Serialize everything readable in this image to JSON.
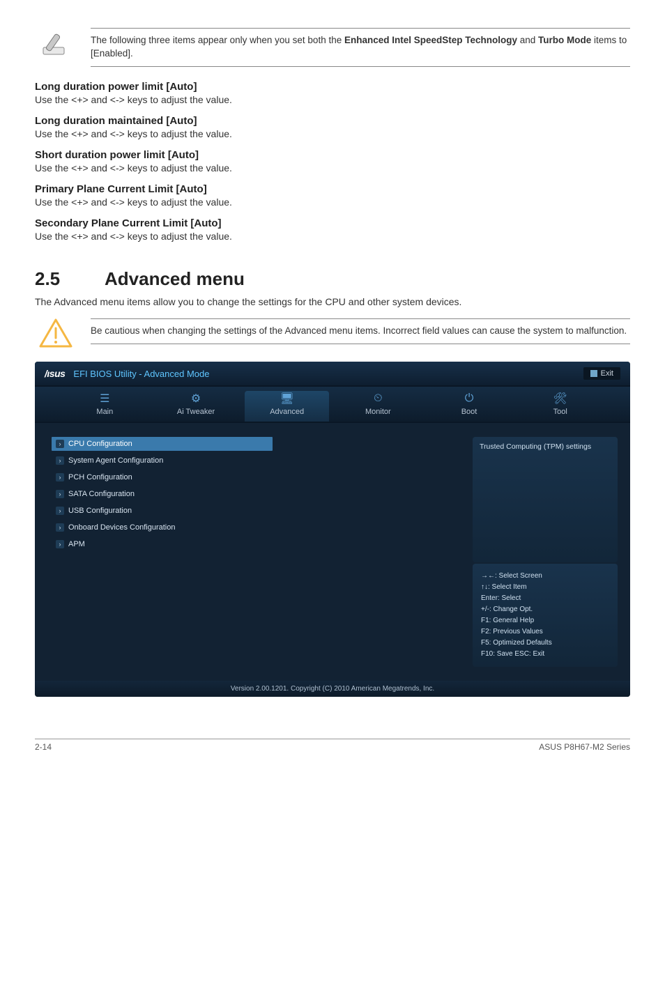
{
  "note1": {
    "line1_pre": "The following three items appear only when you set both the ",
    "bold1": "Enhanced Intel SpeedStep Technology",
    "mid": " and ",
    "bold2": "Turbo Mode",
    "post": " items to [Enabled]."
  },
  "sections": {
    "s1": {
      "heading": "Long duration power limit [Auto]",
      "body": "Use the <+> and <-> keys to adjust the value."
    },
    "s2": {
      "heading": "Long duration maintained [Auto]",
      "body": "Use the <+> and <-> keys to adjust the value."
    },
    "s3": {
      "heading": "Short duration power limit [Auto]",
      "body": "Use the <+> and <-> keys to adjust the value."
    },
    "s4": {
      "heading": "Primary Plane Current Limit [Auto]",
      "body": "Use the <+> and <-> keys to adjust the value."
    },
    "s5": {
      "heading": "Secondary Plane Current Limit [Auto]",
      "body": "Use the <+> and <-> keys to adjust the value."
    }
  },
  "chapter": {
    "num": "2.5",
    "title": "Advanced menu",
    "desc": "The Advanced menu items allow you to change the settings for the CPU and other system devices."
  },
  "warning": {
    "text": "Be cautious when changing the settings of the Advanced menu items. Incorrect field values can cause the system to malfunction."
  },
  "bios": {
    "logo": "/ısus",
    "title": "EFI BIOS Utility - Advanced Mode",
    "exit": "Exit",
    "tabs": {
      "t0": "Main",
      "t1": "Ai Tweaker",
      "t2": "Advanced",
      "t3": "Monitor",
      "t4": "Boot",
      "t5": "Tool"
    },
    "tab_icons": {
      "t0": "☰",
      "t1": "⚙",
      "t2": "🖥",
      "t3": "⏲",
      "t4": "⏻",
      "t5": "🛠"
    },
    "menu": {
      "m0": "CPU Configuration",
      "m1": "System Agent Configuration",
      "m2": "PCH Configuration",
      "m3": "SATA Configuration",
      "m4": "USB Configuration",
      "m5": "Onboard Devices Configuration",
      "m6": "APM"
    },
    "help_top": "Trusted Computing (TPM) settings",
    "help_bottom": {
      "l0": "→←:  Select Screen",
      "l1": "↑↓:  Select Item",
      "l2": "Enter:  Select",
      "l3": "+/-:  Change Opt.",
      "l4": "F1:  General Help",
      "l5": "F2:  Previous Values",
      "l6": "F5:  Optimized Defaults",
      "l7": "F10:  Save    ESC:  Exit"
    },
    "version": "Version  2.00.1201.   Copyright  (C)  2010 American  Megatrends,  Inc."
  },
  "footer": {
    "left": "2-14",
    "right": "ASUS P8H67-M2 Series"
  }
}
